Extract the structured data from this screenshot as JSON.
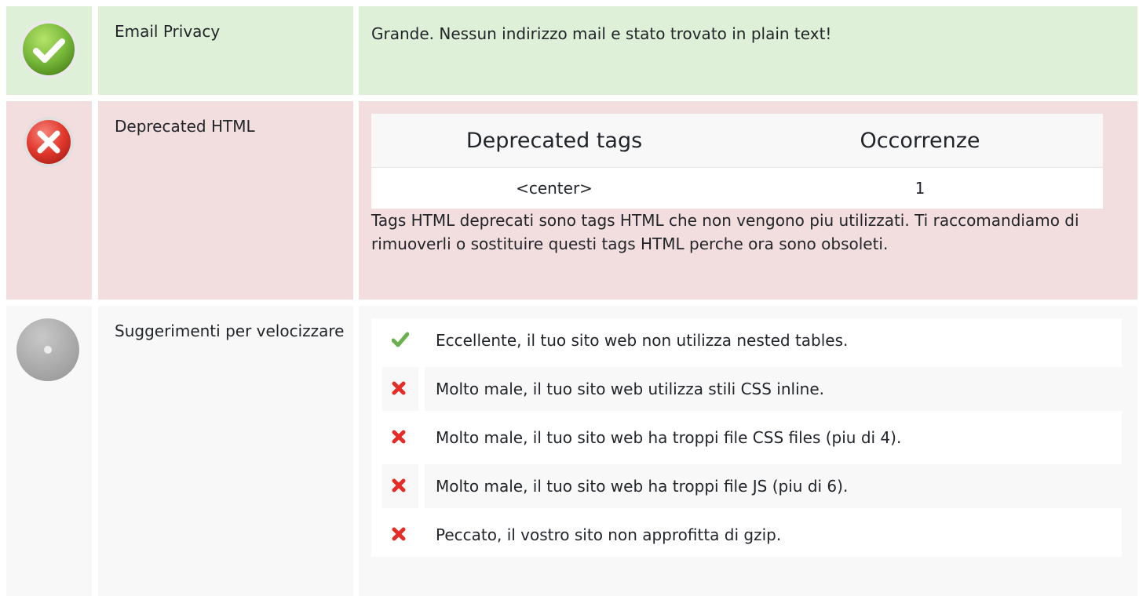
{
  "rows": {
    "email": {
      "status": "good",
      "status_icon": "check-circle-icon",
      "title": "Email Privacy",
      "text": "Grande. Nessun indirizzo mail e stato trovato in plain text!"
    },
    "deprecated": {
      "status": "bad",
      "status_icon": "error-circle-icon",
      "title": "Deprecated HTML",
      "table": {
        "headers": [
          "Deprecated tags",
          "Occorrenze"
        ],
        "rows": [
          [
            "<center>",
            "1"
          ]
        ]
      },
      "description": "Tags HTML deprecati sono tags HTML che non vengono piu utilizzati. Ti raccomandiamo di rimuoverli o sostituire questi tags HTML perche ora sono obsoleti."
    },
    "speed": {
      "status": "neutral",
      "status_icon": "info-circle-icon",
      "title": "Suggerimenti per velocizzare",
      "items": [
        {
          "status": "pass",
          "icon": "checkmark-icon",
          "text": "Eccellente, il tuo sito web non utilizza nested tables."
        },
        {
          "status": "fail",
          "icon": "cross-icon",
          "text": "Molto male, il tuo sito web utilizza stili CSS inline."
        },
        {
          "status": "fail",
          "icon": "cross-icon",
          "text": "Molto male, il tuo sito web ha troppi file CSS files (piu di 4)."
        },
        {
          "status": "fail",
          "icon": "cross-icon",
          "text": "Molto male, il tuo sito web ha troppi file JS (piu di 6)."
        },
        {
          "status": "fail",
          "icon": "cross-icon",
          "text": "Peccato, il vostro sito non approfitta di gzip."
        }
      ]
    }
  },
  "colors": {
    "good_bg": "#dff0d8",
    "bad_bg": "#f2dede",
    "neutral_bg": "#f8f8f8",
    "pass_green": "#6ab04c",
    "fail_red": "#e52d27"
  }
}
